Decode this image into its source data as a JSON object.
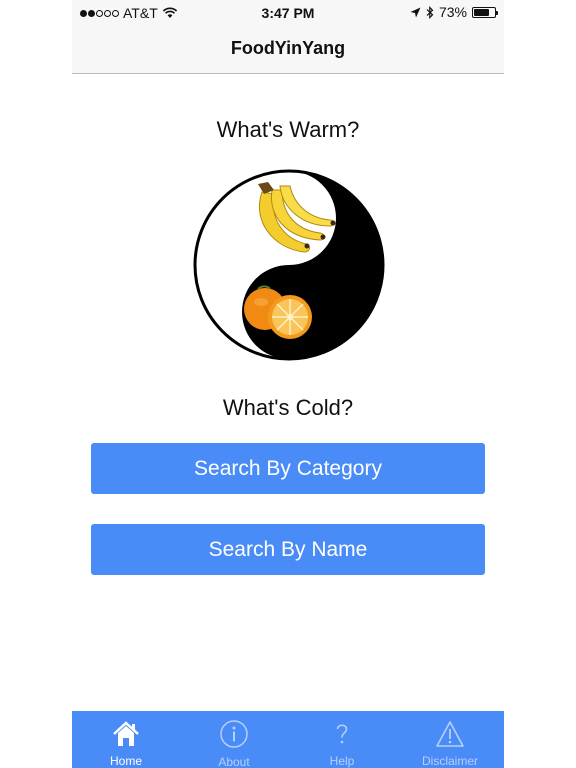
{
  "status_bar": {
    "carrier": "AT&T",
    "time": "3:47 PM",
    "battery": "73%",
    "battery_level": 0.73,
    "signal_bars": 2,
    "icons": [
      "wifi-icon",
      "location-arrow-icon",
      "bluetooth-icon",
      "battery-icon"
    ]
  },
  "nav": {
    "title": "FoodYinYang"
  },
  "main": {
    "warm_heading": "What's Warm?",
    "cold_heading": "What's Cold?",
    "image": {
      "icon": "yin-yang-icon",
      "top_food": "banana",
      "bottom_food": "orange"
    }
  },
  "buttons": {
    "category": "Search By Category",
    "name": "Search By Name"
  },
  "tabbar": {
    "items": [
      {
        "label": "Home",
        "icon": "home-icon",
        "active": true
      },
      {
        "label": "About",
        "icon": "info-icon",
        "active": false
      },
      {
        "label": "Help",
        "icon": "question-icon",
        "active": false
      },
      {
        "label": "Disclaimer",
        "icon": "warning-icon",
        "active": false
      }
    ]
  },
  "colors": {
    "accent": "#4a8cf7",
    "nav_bg": "#f7f7f7",
    "inactive_tab": "#b7d0fb"
  }
}
